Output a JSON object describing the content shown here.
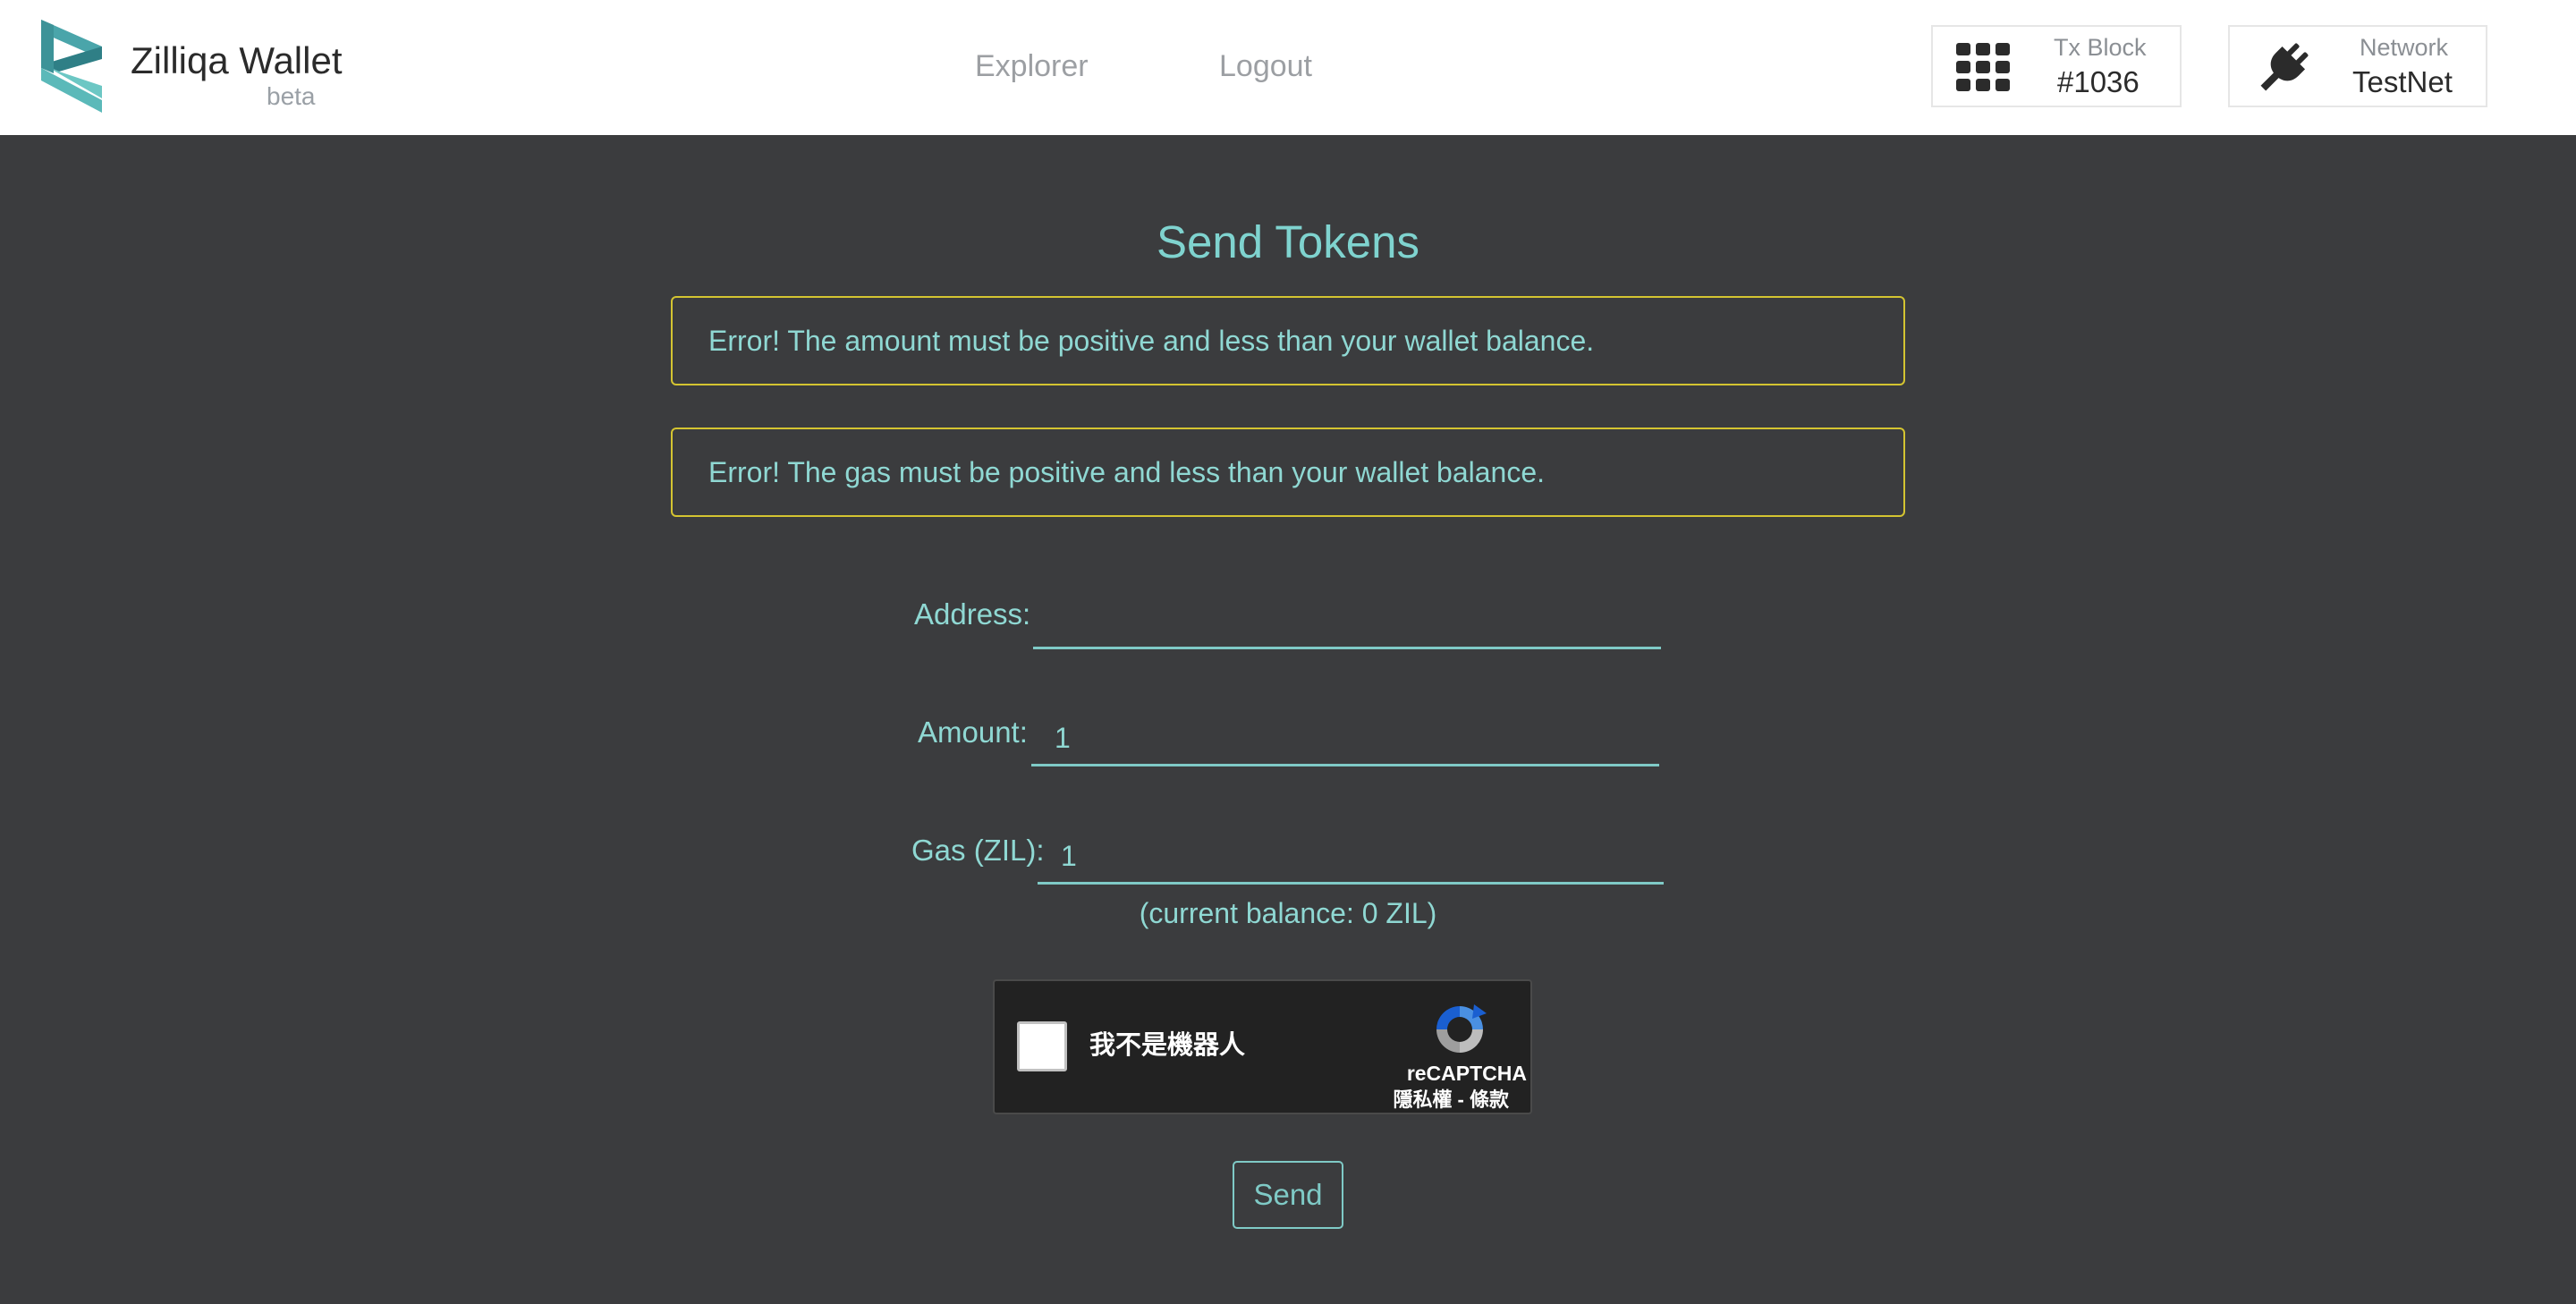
{
  "header": {
    "brand_name": "Zilliqa Wallet",
    "brand_tag": "beta",
    "nav": {
      "explorer": "Explorer",
      "logout": "Logout"
    },
    "tx_block": {
      "label": "Tx Block",
      "value": "#1036",
      "icon": "grid-icon"
    },
    "network": {
      "label": "Network",
      "value": "TestNet",
      "icon": "plug-icon"
    }
  },
  "main": {
    "title": "Send Tokens",
    "alerts": [
      "Error! The amount must be positive and less than your wallet balance.",
      "Error! The gas must be positive and less than your wallet balance."
    ],
    "form": {
      "address_label": "Address:",
      "address_value": "",
      "amount_label": "Amount:",
      "amount_value": "1",
      "gas_label": "Gas (ZIL):",
      "gas_value": "1",
      "balance_note": "(current balance: 0 ZIL)"
    },
    "captcha": {
      "checkbox_label": "我不是機器人",
      "brand": "reCAPTCHA",
      "links": "隱私權 - 條款"
    },
    "send_label": "Send"
  },
  "colors": {
    "accent": "#7fd3cf",
    "background": "#3b3c3e",
    "alert_border": "#d4c431",
    "header_bg": "#ffffff"
  }
}
